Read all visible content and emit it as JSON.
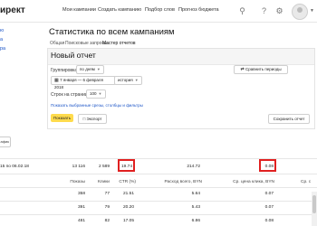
{
  "header": {
    "logo": "ирект",
    "nav": [
      "Мои кампании",
      "Создать кампанию",
      "Подбор слов",
      "Прогноз бюджета"
    ]
  },
  "sidebar": {
    "items": [
      "ю",
      "а",
      "ра"
    ]
  },
  "page": {
    "title": "Статистика по всем кампаниям",
    "tabs": [
      "Общая",
      "Поисковые запросы",
      "Мастер отчетов"
    ]
  },
  "report": {
    "title": "Новый отчет",
    "grouping_label": "Группировка",
    "grouping_value": "по дням",
    "compare_button": "Сравнить периоды",
    "date_range": "7 января — 6 февраля 2018",
    "history_value": "история",
    "rows_per_page_label": "Строк на странице",
    "rows_per_page_value": "100",
    "columns_link": "Показать выбранные срезы, столбцы и фильтры",
    "show_button": "Показать",
    "export_button": "Экспорт",
    "save_button": "Сохранить отчет"
  },
  "left_button": {
    "label": "афик"
  },
  "table": {
    "summary": {
      "period": "15 по 06.02.18",
      "impressions": "13 116",
      "clicks": "2 589",
      "ctr": "19.74",
      "spend": "214.72",
      "cpc": "0.08"
    },
    "headers": [
      "Показы",
      "Клики",
      "CTR (%)",
      "Расход всего, BYN",
      "Ср. цена клика, BYN",
      "Ср. с"
    ],
    "rows": [
      [
        "358",
        "77",
        "21.51",
        "5.64",
        "0.07"
      ],
      [
        "391",
        "79",
        "20.20",
        "5.43",
        "0.07"
      ],
      [
        "481",
        "82",
        "17.05",
        "6.86",
        "0.08"
      ]
    ]
  }
}
